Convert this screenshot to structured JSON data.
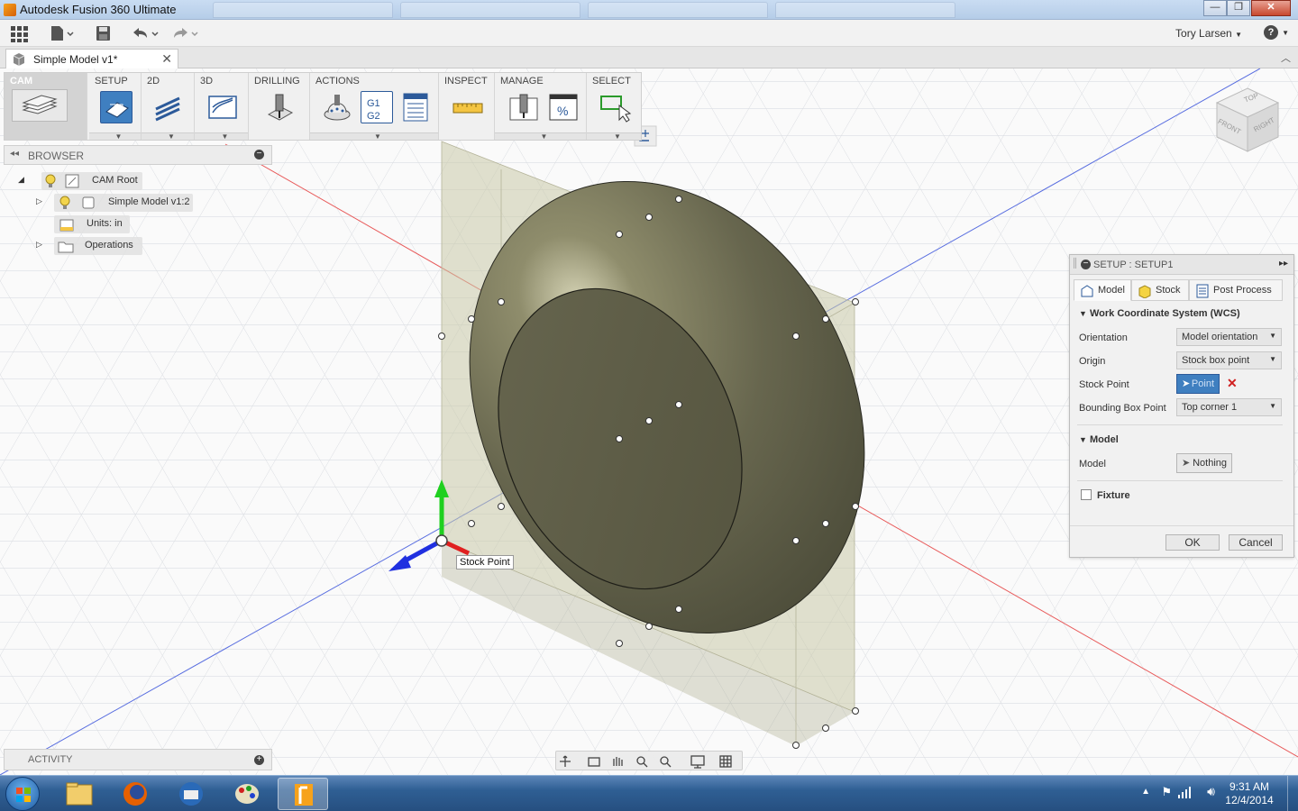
{
  "window": {
    "title": "Autodesk Fusion 360 Ultimate",
    "minimize": "—",
    "maximize": "❐",
    "close": "✕"
  },
  "quick_access": {
    "user_name": "Tory Larsen",
    "user_arrow": "▼",
    "help": "?"
  },
  "document_tab": {
    "title": "Simple Model v1*",
    "close": "✕"
  },
  "ribbon": {
    "workspace": "CAM",
    "groups": [
      "SETUP",
      "2D",
      "3D",
      "DRILLING",
      "ACTIONS",
      "INSPECT",
      "MANAGE",
      "SELECT"
    ]
  },
  "browser": {
    "title": "BROWSER",
    "items": [
      {
        "label": "CAM Root"
      },
      {
        "label": "Simple Model v1:2"
      },
      {
        "label": "Units: in"
      },
      {
        "label": "Operations"
      }
    ]
  },
  "activity": {
    "title": "ACTIVITY"
  },
  "viewcube": {
    "top": "TOP",
    "front": "FRONT",
    "right": "RIGHT"
  },
  "tooltip": "Stock Point",
  "setup_dialog": {
    "title": "SETUP : SETUP1",
    "tabs": [
      "Model",
      "Stock",
      "Post Process"
    ],
    "wcs_section": "Work Coordinate System (WCS)",
    "fields": {
      "orientation_label": "Orientation",
      "orientation_value": "Model orientation",
      "origin_label": "Origin",
      "origin_value": "Stock box point",
      "stock_point_label": "Stock Point",
      "stock_point_value": "Point",
      "bounding_box_label": "Bounding Box Point",
      "bounding_box_value": "Top corner 1"
    },
    "model_section": "Model",
    "model_label": "Model",
    "model_value": "Nothing",
    "fixture_label": "Fixture",
    "ok": "OK",
    "cancel": "Cancel"
  },
  "taskbar": {
    "time": "9:31 AM",
    "date": "12/4/2014"
  },
  "colors": {
    "accent_blue": "#3f7fc0",
    "model_body": "#6b6a52",
    "stock_box": "#c9c8a8",
    "x_axis": "#e02020",
    "y_axis": "#20c020",
    "z_axis": "#2040e0"
  }
}
